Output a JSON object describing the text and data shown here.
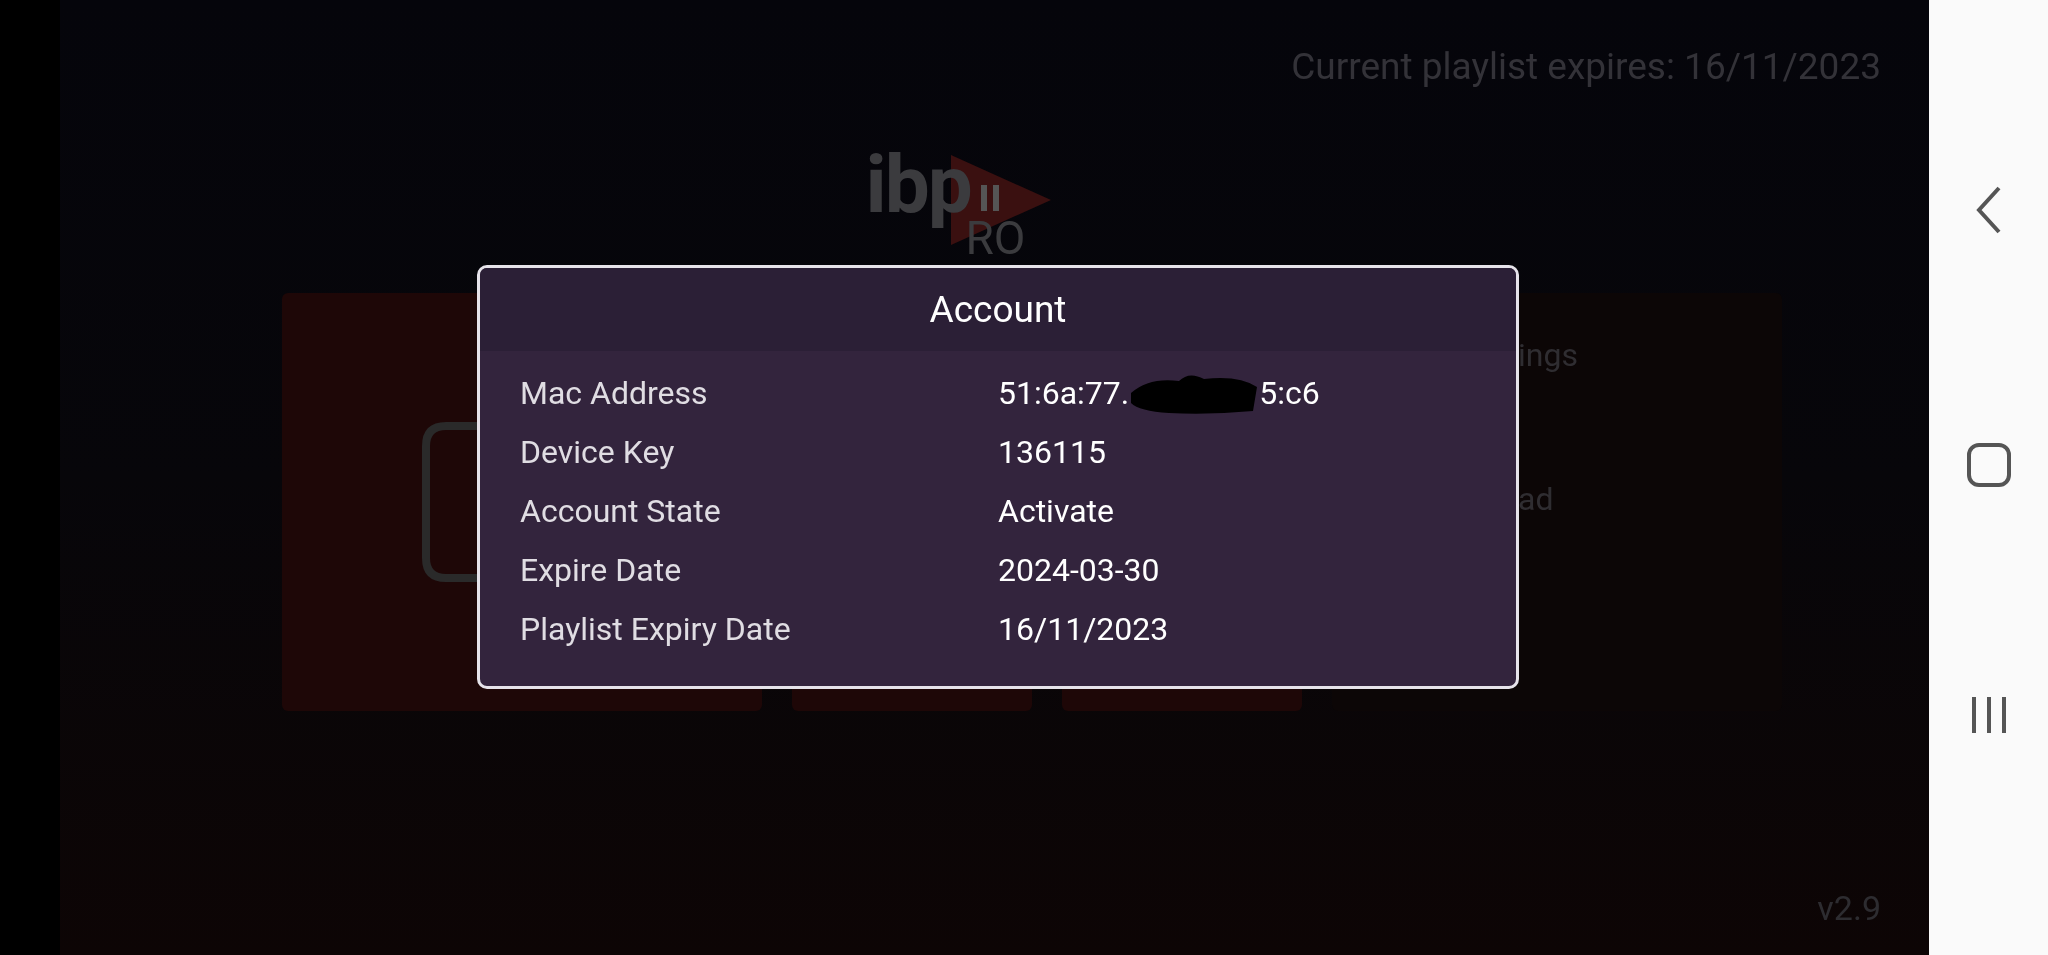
{
  "header": {
    "expiry_notice": "Current playlist expires: 16/11/2023"
  },
  "logo": {
    "left_text": "ibp",
    "right_text": "RO"
  },
  "background_menu": [
    {
      "label": "ings"
    },
    {
      "label": "ad"
    }
  ],
  "dialog": {
    "title": "Account",
    "rows": [
      {
        "label": "Mac Address",
        "value_parts": [
          "51:6a:77.",
          "5:c6"
        ]
      },
      {
        "label": "Device Key",
        "value_parts": [
          "136115"
        ]
      },
      {
        "label": "Account State",
        "value_parts": [
          "Activate"
        ]
      },
      {
        "label": "Expire Date",
        "value_parts": [
          "2024-03-30"
        ]
      },
      {
        "label": "Playlist Expiry Date",
        "value_parts": [
          "16/11/2023"
        ]
      }
    ]
  },
  "version": "v2.9",
  "nav_bar": {
    "buttons": [
      {
        "kind": "back"
      },
      {
        "kind": "home"
      },
      {
        "kind": "recents"
      }
    ]
  }
}
